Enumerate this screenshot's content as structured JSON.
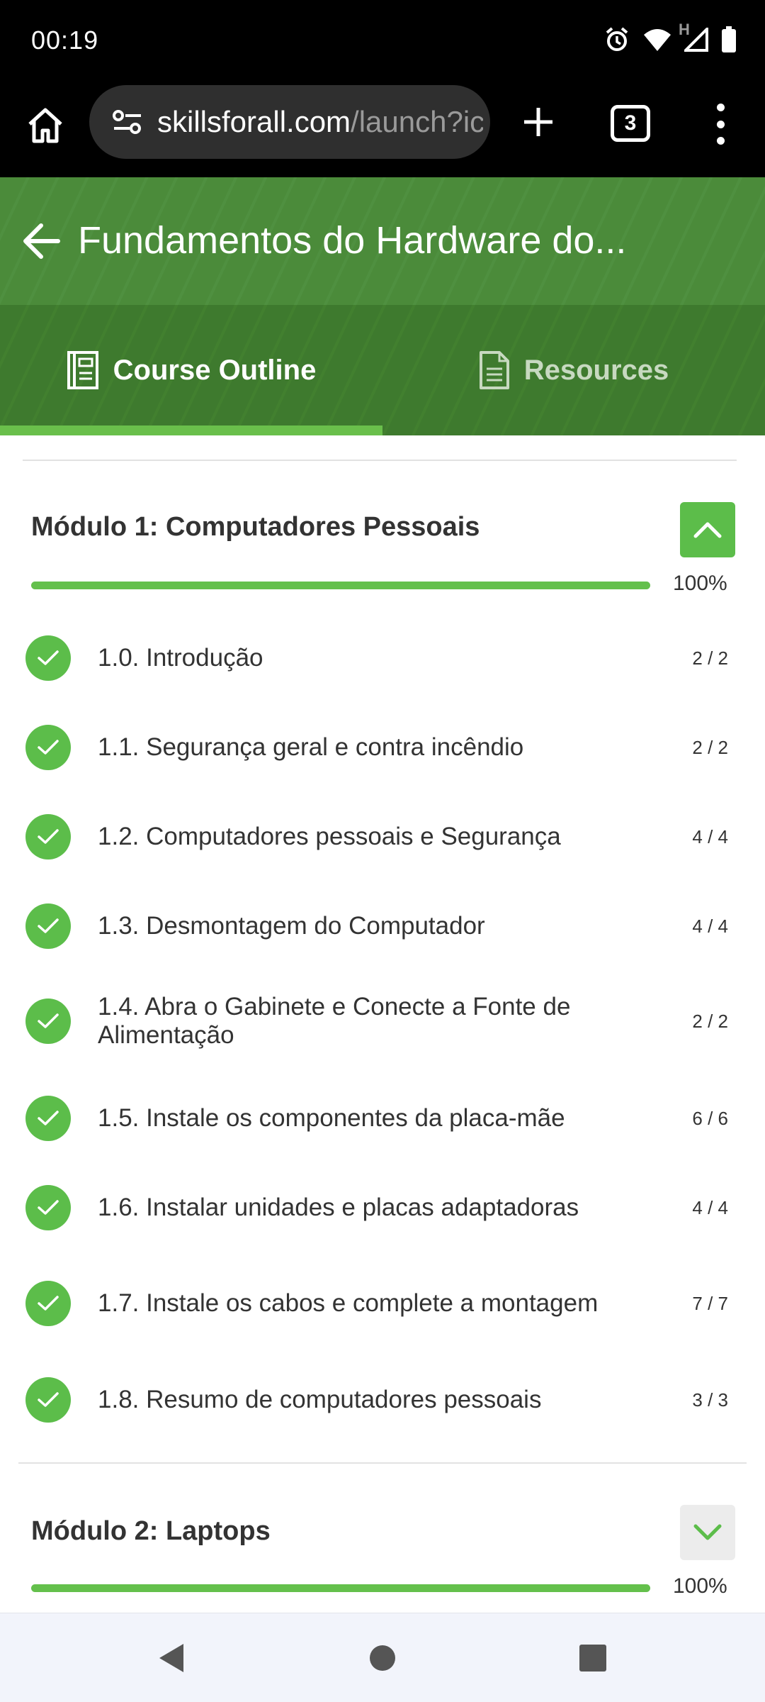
{
  "status_bar": {
    "time": "00:19",
    "network_label": "H",
    "icons": [
      "alarm-icon",
      "wifi-icon",
      "signal-icon",
      "battery-icon"
    ]
  },
  "browser": {
    "url_domain": "skillsforall.com",
    "url_path": "/launch?ic",
    "tab_count": "3",
    "icons": [
      "home-icon",
      "site-info-icon",
      "new-tab-icon",
      "more-vert-icon"
    ]
  },
  "course": {
    "title": "Fundamentos do Hardware do..."
  },
  "tabs": {
    "outline": "Course Outline",
    "resources": "Resources"
  },
  "modules": [
    {
      "title": "Módulo 1: Computadores Pessoais",
      "progress": 100,
      "progress_label": "100%",
      "expanded": true,
      "lessons": [
        {
          "label": "1.0. Introdução",
          "count": "2 / 2"
        },
        {
          "label": "1.1. Segurança geral e contra incêndio",
          "count": "2 / 2"
        },
        {
          "label": "1.2. Computadores pessoais e Segurança",
          "count": "4 / 4"
        },
        {
          "label": "1.3. Desmontagem do Computador",
          "count": "4 / 4"
        },
        {
          "label": "1.4. Abra o Gabinete e Conecte a Fonte de Alimentação",
          "count": "2 / 2"
        },
        {
          "label": "1.5. Instale os componentes da placa-mãe",
          "count": "6 / 6"
        },
        {
          "label": "1.6. Instalar unidades e placas adaptadoras",
          "count": "4 / 4"
        },
        {
          "label": "1.7. Instale os cabos e complete a montagem",
          "count": "7 / 7"
        },
        {
          "label": "1.8. Resumo de computadores pessoais",
          "count": "3 / 3"
        }
      ]
    },
    {
      "title": "Módulo 2: Laptops",
      "progress": 100,
      "progress_label": "100%",
      "expanded": false
    }
  ],
  "colors": {
    "header_green": "#4b8b3a",
    "tab_green": "#3e7a2e",
    "accent_green": "#5cbd4a",
    "progress_green": "#64c04c"
  }
}
